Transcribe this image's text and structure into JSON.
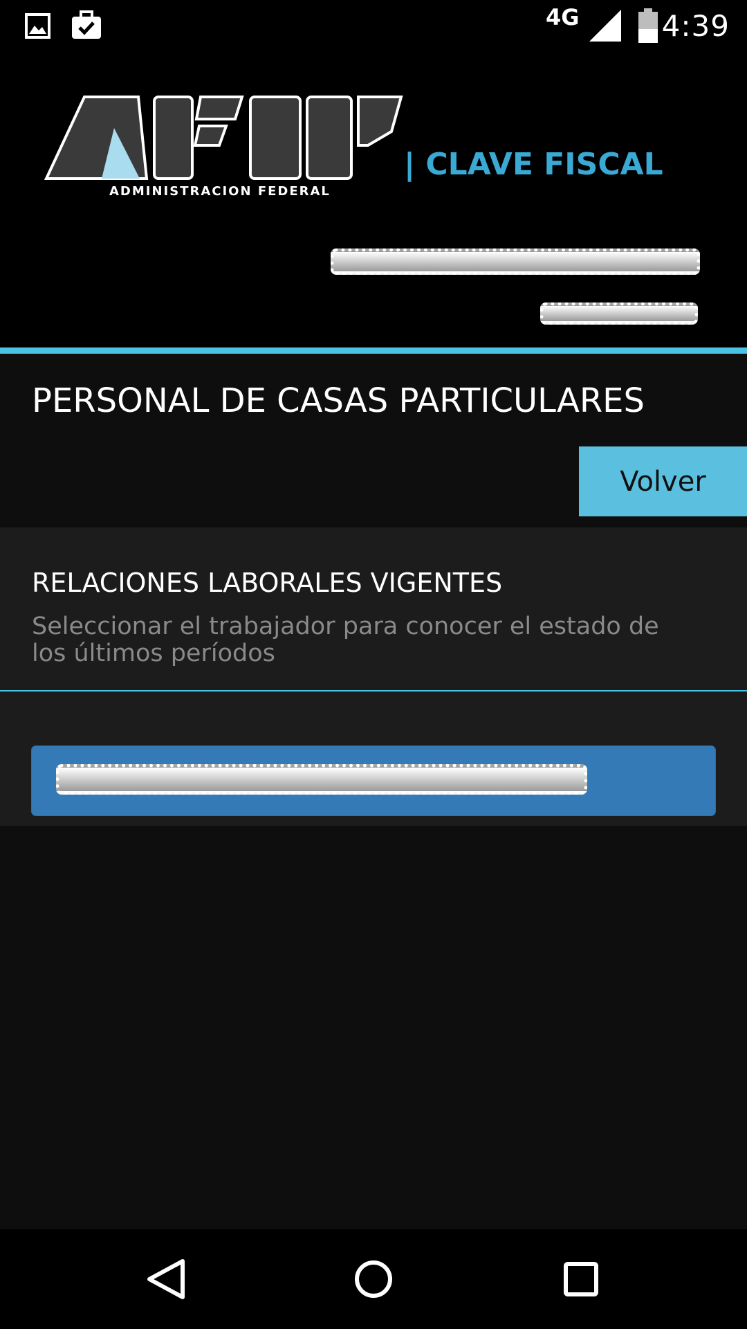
{
  "status_bar": {
    "network": "4G",
    "time": "4:39",
    "icons": [
      "image-notification-icon",
      "briefcase-check-icon",
      "signal-icon",
      "battery-icon"
    ]
  },
  "header": {
    "logo_letters": "AFIP",
    "logo_subtitle": "ADMINISTRACION FEDERAL",
    "product_name": "| CLAVE FISCAL"
  },
  "page": {
    "title": "PERSONAL DE CASAS PARTICULARES",
    "back_button_label": "Volver"
  },
  "relations": {
    "heading": "RELACIONES LABORALES VIGENTES",
    "description": "Seleccionar el trabajador para conocer el estado de los últimos períodos"
  },
  "nav_bar": {
    "icons": [
      "back-triangle-icon",
      "home-circle-icon",
      "recents-square-icon"
    ]
  },
  "colors": {
    "accent": "#4ac3e6",
    "back_button": "#5bbfe0",
    "worker_button": "#337ab7"
  }
}
